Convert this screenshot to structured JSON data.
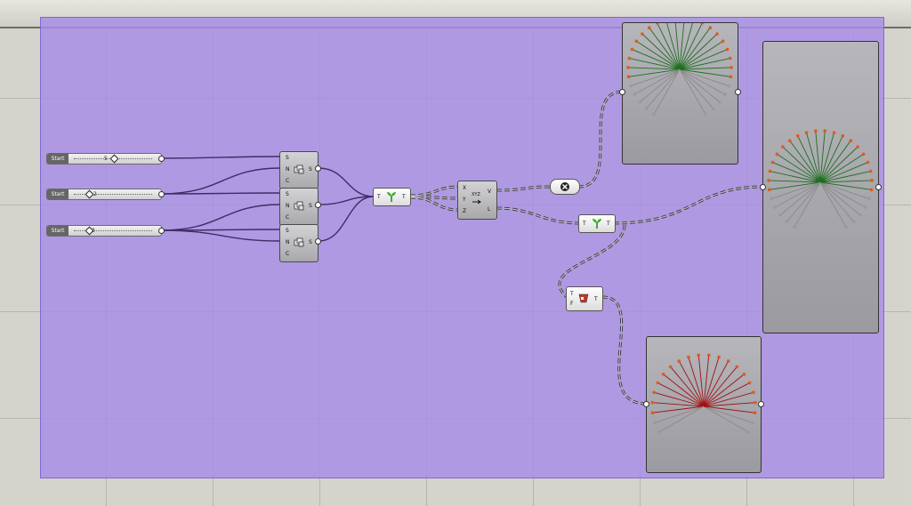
{
  "app": {
    "name": "Grasshopper canvas"
  },
  "sliders": [
    {
      "label": "Start",
      "value": "5"
    },
    {
      "label": "Start",
      "value": "2"
    },
    {
      "label": "Start",
      "value": "2"
    }
  ],
  "series_components": [
    {
      "inputs": [
        "S",
        "N",
        "C"
      ],
      "output": "S"
    },
    {
      "inputs": [
        "S",
        "N",
        "C"
      ],
      "output": "S"
    },
    {
      "inputs": [
        "S",
        "N",
        "C"
      ],
      "output": "S"
    }
  ],
  "graft_component": {
    "input": "T",
    "output": "T"
  },
  "vector_component": {
    "inputs": [
      "X",
      "Y",
      "Z"
    ],
    "outputs": [
      "V",
      "L"
    ],
    "icon_text": "XYZ"
  },
  "graft_component_2": {
    "input": "T",
    "output": "T"
  },
  "dispatch_component": {
    "inputs": [
      "T",
      "F"
    ],
    "output": "T"
  },
  "colors": {
    "group": "#a88ce8",
    "canvas": "#d4d3cc",
    "green_lines": "#1f6e1f",
    "red_lines": "#a01010",
    "points": "#e05a1a"
  }
}
